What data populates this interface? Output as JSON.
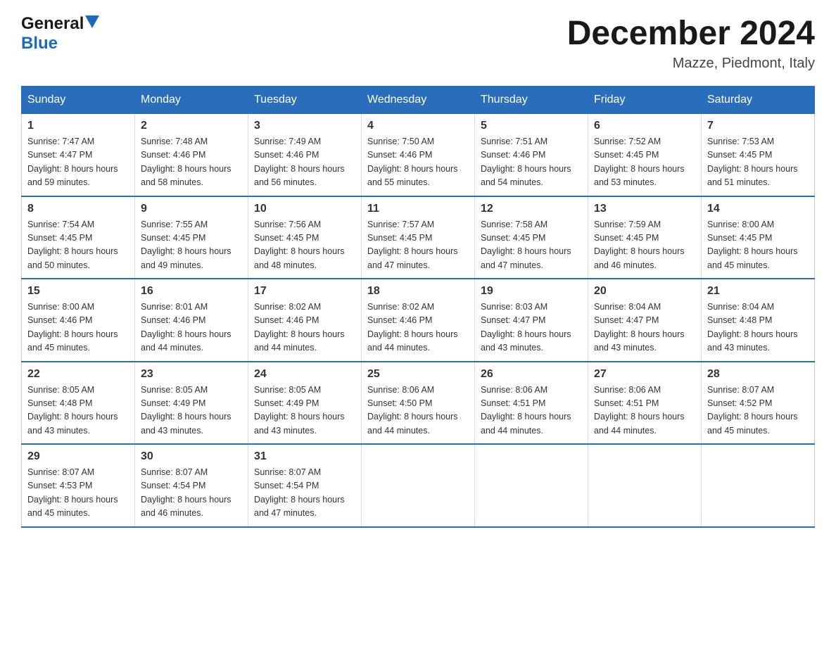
{
  "header": {
    "logo_general": "General",
    "logo_blue": "Blue",
    "month_title": "December 2024",
    "location": "Mazze, Piedmont, Italy"
  },
  "weekdays": [
    "Sunday",
    "Monday",
    "Tuesday",
    "Wednesday",
    "Thursday",
    "Friday",
    "Saturday"
  ],
  "weeks": [
    [
      {
        "day": "1",
        "sunrise": "7:47 AM",
        "sunset": "4:47 PM",
        "daylight": "8 hours and 59 minutes."
      },
      {
        "day": "2",
        "sunrise": "7:48 AM",
        "sunset": "4:46 PM",
        "daylight": "8 hours and 58 minutes."
      },
      {
        "day": "3",
        "sunrise": "7:49 AM",
        "sunset": "4:46 PM",
        "daylight": "8 hours and 56 minutes."
      },
      {
        "day": "4",
        "sunrise": "7:50 AM",
        "sunset": "4:46 PM",
        "daylight": "8 hours and 55 minutes."
      },
      {
        "day": "5",
        "sunrise": "7:51 AM",
        "sunset": "4:46 PM",
        "daylight": "8 hours and 54 minutes."
      },
      {
        "day": "6",
        "sunrise": "7:52 AM",
        "sunset": "4:45 PM",
        "daylight": "8 hours and 53 minutes."
      },
      {
        "day": "7",
        "sunrise": "7:53 AM",
        "sunset": "4:45 PM",
        "daylight": "8 hours and 51 minutes."
      }
    ],
    [
      {
        "day": "8",
        "sunrise": "7:54 AM",
        "sunset": "4:45 PM",
        "daylight": "8 hours and 50 minutes."
      },
      {
        "day": "9",
        "sunrise": "7:55 AM",
        "sunset": "4:45 PM",
        "daylight": "8 hours and 49 minutes."
      },
      {
        "day": "10",
        "sunrise": "7:56 AM",
        "sunset": "4:45 PM",
        "daylight": "8 hours and 48 minutes."
      },
      {
        "day": "11",
        "sunrise": "7:57 AM",
        "sunset": "4:45 PM",
        "daylight": "8 hours and 47 minutes."
      },
      {
        "day": "12",
        "sunrise": "7:58 AM",
        "sunset": "4:45 PM",
        "daylight": "8 hours and 47 minutes."
      },
      {
        "day": "13",
        "sunrise": "7:59 AM",
        "sunset": "4:45 PM",
        "daylight": "8 hours and 46 minutes."
      },
      {
        "day": "14",
        "sunrise": "8:00 AM",
        "sunset": "4:45 PM",
        "daylight": "8 hours and 45 minutes."
      }
    ],
    [
      {
        "day": "15",
        "sunrise": "8:00 AM",
        "sunset": "4:46 PM",
        "daylight": "8 hours and 45 minutes."
      },
      {
        "day": "16",
        "sunrise": "8:01 AM",
        "sunset": "4:46 PM",
        "daylight": "8 hours and 44 minutes."
      },
      {
        "day": "17",
        "sunrise": "8:02 AM",
        "sunset": "4:46 PM",
        "daylight": "8 hours and 44 minutes."
      },
      {
        "day": "18",
        "sunrise": "8:02 AM",
        "sunset": "4:46 PM",
        "daylight": "8 hours and 44 minutes."
      },
      {
        "day": "19",
        "sunrise": "8:03 AM",
        "sunset": "4:47 PM",
        "daylight": "8 hours and 43 minutes."
      },
      {
        "day": "20",
        "sunrise": "8:04 AM",
        "sunset": "4:47 PM",
        "daylight": "8 hours and 43 minutes."
      },
      {
        "day": "21",
        "sunrise": "8:04 AM",
        "sunset": "4:48 PM",
        "daylight": "8 hours and 43 minutes."
      }
    ],
    [
      {
        "day": "22",
        "sunrise": "8:05 AM",
        "sunset": "4:48 PM",
        "daylight": "8 hours and 43 minutes."
      },
      {
        "day": "23",
        "sunrise": "8:05 AM",
        "sunset": "4:49 PM",
        "daylight": "8 hours and 43 minutes."
      },
      {
        "day": "24",
        "sunrise": "8:05 AM",
        "sunset": "4:49 PM",
        "daylight": "8 hours and 43 minutes."
      },
      {
        "day": "25",
        "sunrise": "8:06 AM",
        "sunset": "4:50 PM",
        "daylight": "8 hours and 44 minutes."
      },
      {
        "day": "26",
        "sunrise": "8:06 AM",
        "sunset": "4:51 PM",
        "daylight": "8 hours and 44 minutes."
      },
      {
        "day": "27",
        "sunrise": "8:06 AM",
        "sunset": "4:51 PM",
        "daylight": "8 hours and 44 minutes."
      },
      {
        "day": "28",
        "sunrise": "8:07 AM",
        "sunset": "4:52 PM",
        "daylight": "8 hours and 45 minutes."
      }
    ],
    [
      {
        "day": "29",
        "sunrise": "8:07 AM",
        "sunset": "4:53 PM",
        "daylight": "8 hours and 45 minutes."
      },
      {
        "day": "30",
        "sunrise": "8:07 AM",
        "sunset": "4:54 PM",
        "daylight": "8 hours and 46 minutes."
      },
      {
        "day": "31",
        "sunrise": "8:07 AM",
        "sunset": "4:54 PM",
        "daylight": "8 hours and 47 minutes."
      },
      null,
      null,
      null,
      null
    ]
  ],
  "labels": {
    "sunrise": "Sunrise:",
    "sunset": "Sunset:",
    "daylight": "Daylight:"
  }
}
